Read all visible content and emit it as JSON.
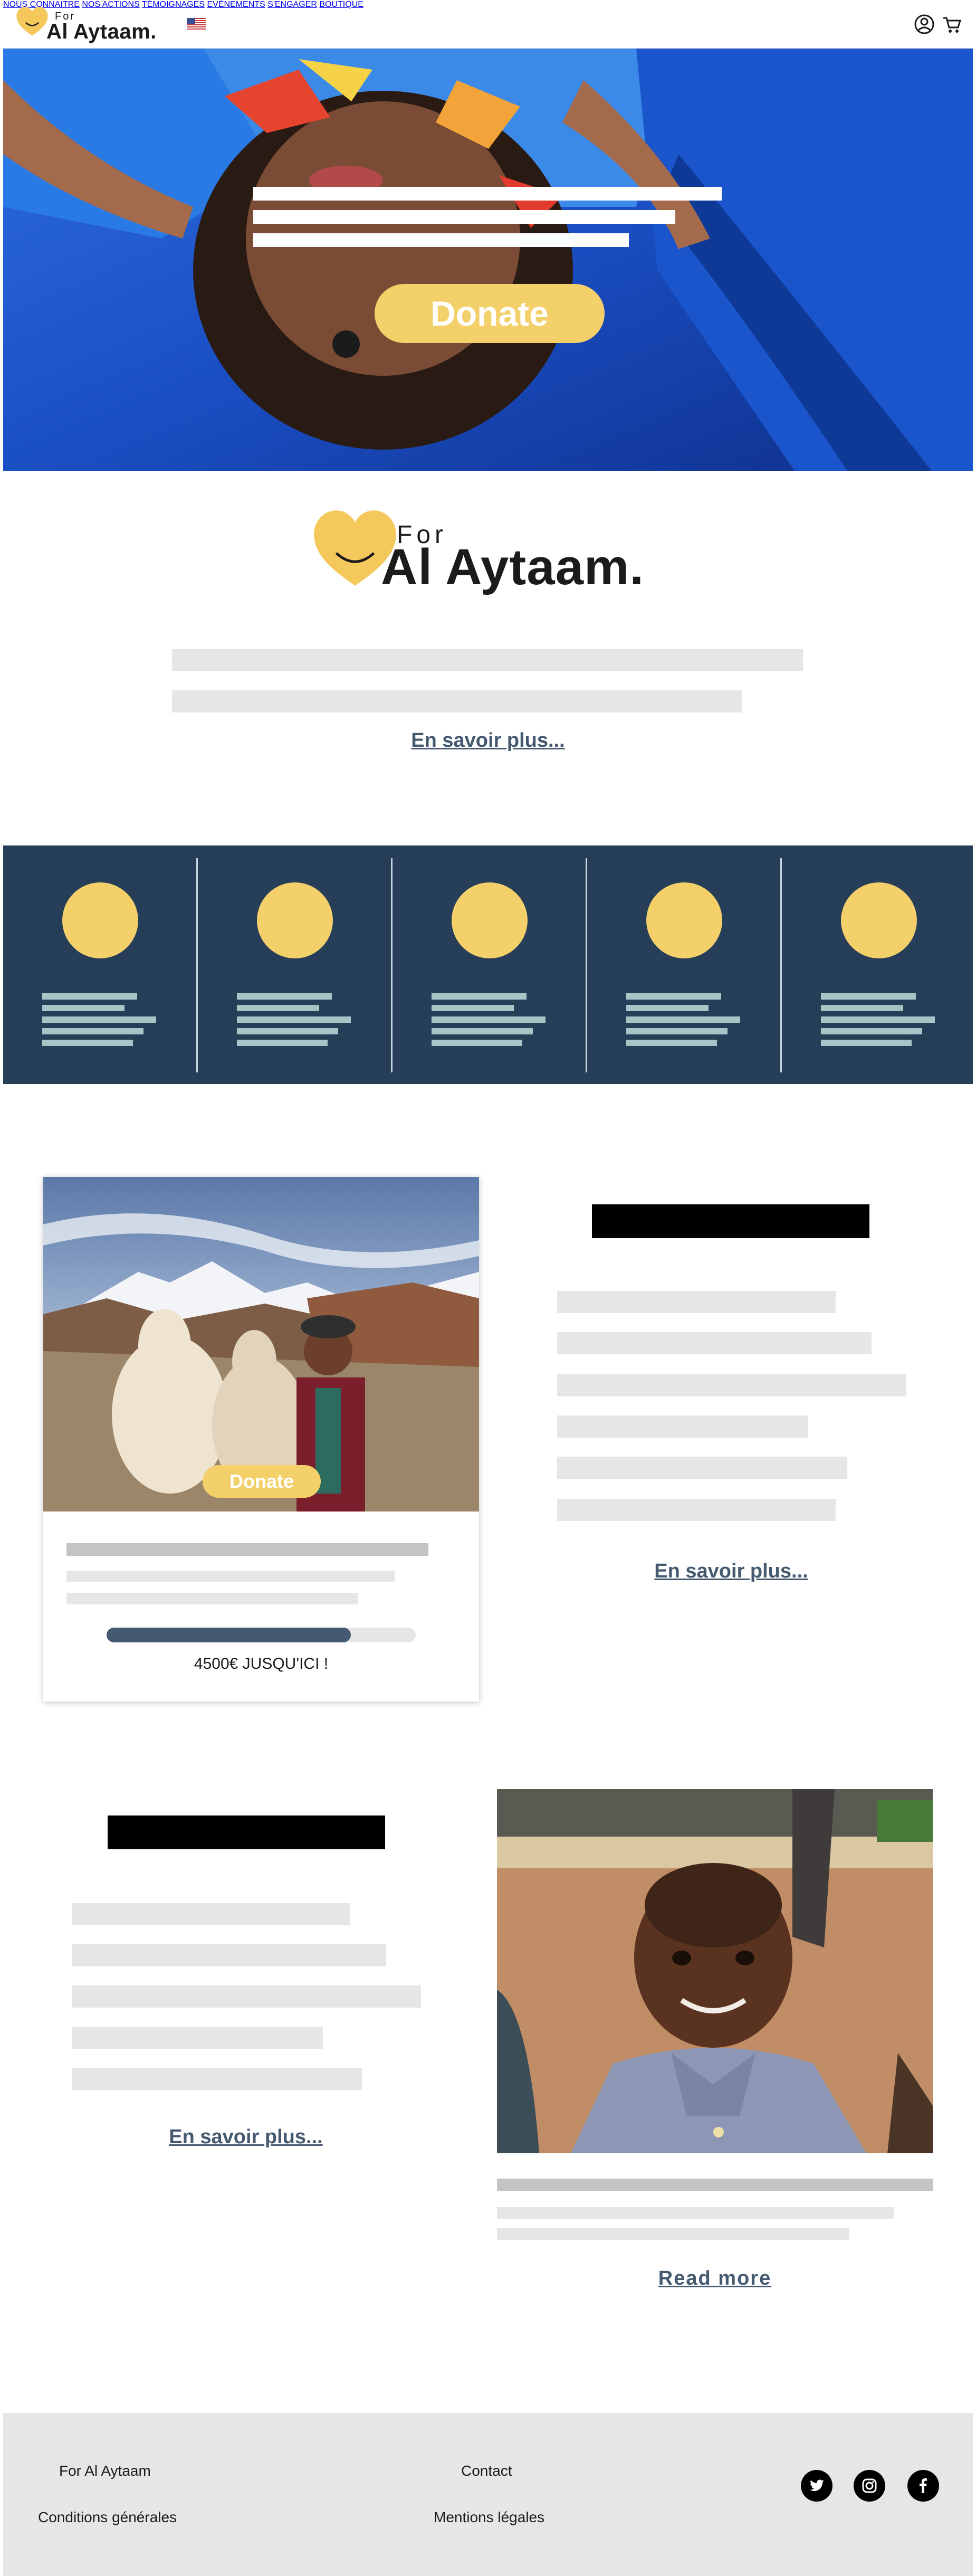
{
  "header": {
    "logo": {
      "for": "For",
      "name": "Al Aytaam."
    },
    "language_flag": "us-flag-icon",
    "nav": [
      {
        "label": "NOUS CONNAITRE"
      },
      {
        "label": "NOS ACTIONS"
      },
      {
        "label": "TÉMOIGNAGES"
      },
      {
        "label": "EVÉNEMENTS"
      },
      {
        "label": "S'ENGAGER"
      },
      {
        "label": "BOUTIQUE"
      }
    ],
    "icons": [
      "account-icon",
      "cart-icon"
    ]
  },
  "hero": {
    "donate_label": "Donate"
  },
  "intro": {
    "logo": {
      "for": "For",
      "name": "Al Aytaam."
    },
    "more_label": "En savoir plus..."
  },
  "campaign_card": {
    "donate_label": "Donate",
    "progress_text": "4500€ JUSQU'ICI !",
    "progress_fraction": 0.79
  },
  "section_one": {
    "more_label": "En savoir plus..."
  },
  "section_two": {
    "more_label": "En savoir plus..."
  },
  "child_card": {
    "read_more_label": "Read more"
  },
  "footer": {
    "links": {
      "about": "For Al Aytaam",
      "contact": "Contact",
      "terms": "Conditions générales",
      "legal": "Mentions légales"
    },
    "social": [
      "twitter-icon",
      "instagram-icon",
      "facebook-icon"
    ]
  },
  "colors": {
    "brand_yellow": "#f4d06b",
    "navy": "#263e57",
    "slate": "#455a70",
    "placeholder_grey": "#e6e6e6",
    "footer_grey": "#e6e6e6"
  }
}
